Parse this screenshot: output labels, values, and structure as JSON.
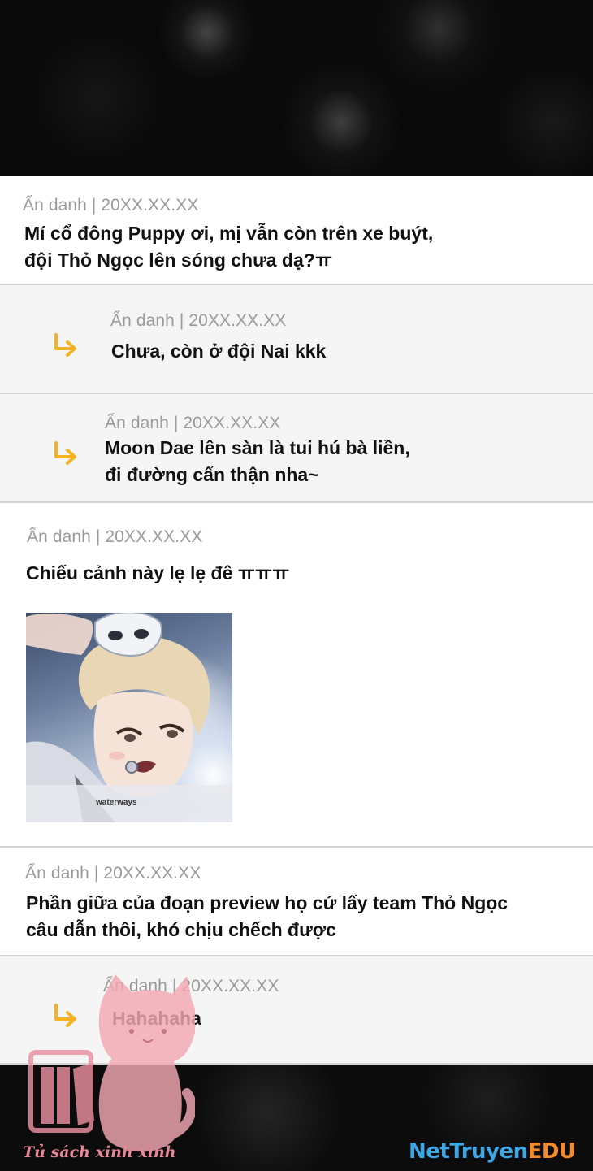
{
  "comments": [
    {
      "meta": "Ẩn danh | 20XX.XX.XX",
      "lines": [
        "Mí cổ đông Puppy ơi, mị vẫn còn trên xe buýt,",
        "đội Thỏ Ngọc lên sóng chưa dạ?ㅠ"
      ]
    },
    {
      "meta": "Ẩn danh | 20XX.XX.XX",
      "lines": [
        "Chưa, còn ở đội Nai kkk"
      ]
    },
    {
      "meta": "Ẩn danh | 20XX.XX.XX",
      "lines": [
        "Moon Dae lên sàn là tui hú bà liền,",
        "đi đường cẩn thận nha~"
      ]
    },
    {
      "meta": "Ẩn danh | 20XX.XX.XX",
      "lines": [
        "Chiếu cảnh này lẹ lẹ đê ㅠㅠㅠ"
      ],
      "image_caption": "waterways"
    },
    {
      "meta": "Ẩn danh | 20XX.XX.XX",
      "lines": [
        "Phần giữa của đoạn preview họ cứ lấy team Thỏ Ngọc",
        "câu dẫn thôi, khó chịu chếch được"
      ]
    },
    {
      "meta": "Ẩn danh | 20XX.XX.XX",
      "lines": [
        "Hahahaha"
      ]
    }
  ],
  "watermark": {
    "label": "Tủ sách xinh xinh",
    "site_part1": "NetTruyen",
    "site_part2": "EDU"
  },
  "colors": {
    "reply_arrow": "#f2b424",
    "meta_text": "#9a9a9a",
    "body_text": "#111111",
    "reply_background": "#f5f5f5",
    "divider": "#d4d4d4"
  }
}
